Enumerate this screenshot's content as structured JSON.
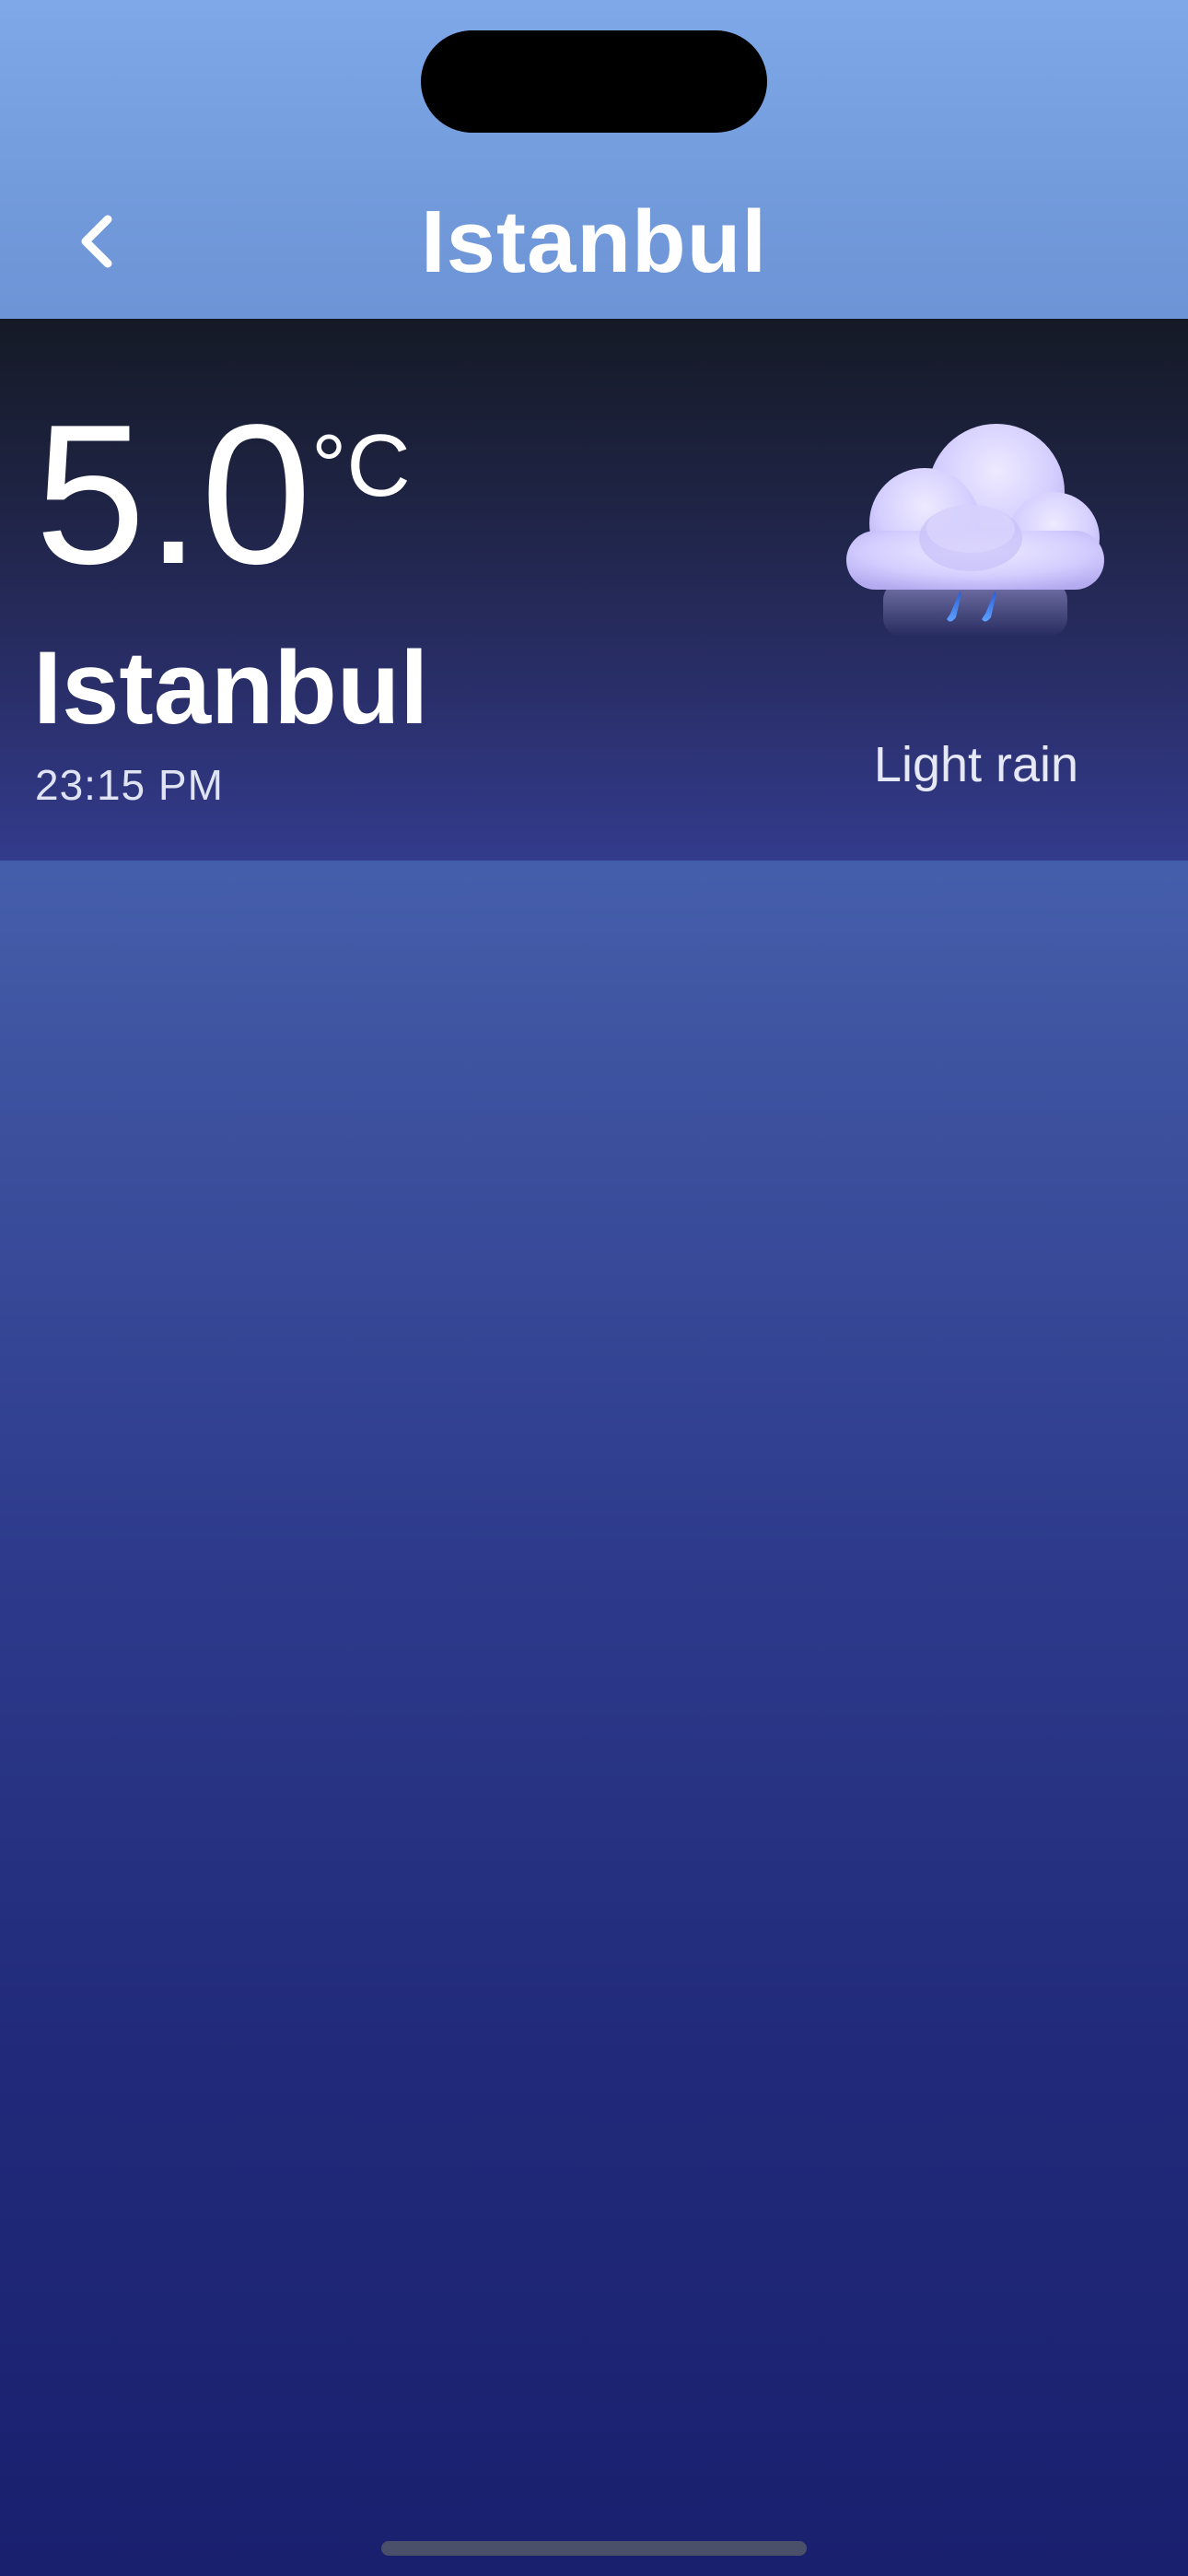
{
  "nav": {
    "title": "Istanbul",
    "back_icon": "chevron-left-icon"
  },
  "weather": {
    "temperature": "5.0",
    "unit": "°C",
    "city": "Istanbul",
    "local_time": "23:15 PM",
    "condition": "Light rain",
    "condition_icon": "light-rain-cloud-icon"
  },
  "colors": {
    "nav_bar": "#7aa3e4",
    "card_top": "#151a26",
    "card_bottom": "#333b8c",
    "background_top": "#5e80c6",
    "background_bottom": "#19206e",
    "rain_drop": "#3b7cf0"
  }
}
